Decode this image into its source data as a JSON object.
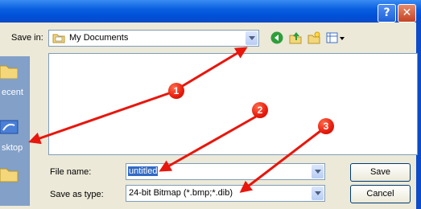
{
  "titlebar": {
    "help_label": "?",
    "close_label": "✕"
  },
  "toolbar": {
    "save_in_label": "Save in:",
    "location_value": "My Documents",
    "icons": [
      "back-icon",
      "up-folder-icon",
      "new-folder-icon",
      "views-menu-icon"
    ]
  },
  "places": [
    {
      "label": "ecent",
      "icon": "recent-icon"
    },
    {
      "label": "sktop",
      "icon": "desktop-icon"
    },
    {
      "label": "",
      "icon": "my-documents-icon"
    }
  ],
  "form": {
    "file_name_label": "File name:",
    "file_name_value": "untitled",
    "save_as_type_label": "Save as type:",
    "save_as_type_value": "24-bit Bitmap (*.bmp;*.dib)"
  },
  "buttons": {
    "save_label": "Save",
    "cancel_label": "Cancel"
  },
  "annotations": {
    "callout_1": "1",
    "callout_2": "2",
    "callout_3": "3",
    "arrow_color": "#e8160c"
  }
}
